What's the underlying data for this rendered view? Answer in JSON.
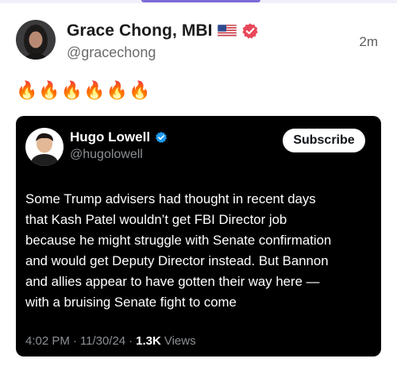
{
  "author": {
    "name": "Grace Chong, MBI",
    "flag": "🇺🇸",
    "handle": "@gracechong",
    "verified_icon": "verified-badge-icon",
    "verified_color": "#e8485a"
  },
  "post": {
    "timestamp": "2m",
    "text": "🔥🔥🔥🔥🔥🔥"
  },
  "embed": {
    "author_name": "Hugo Lowell",
    "author_handle": "@hugolowell",
    "verified_color": "#1d9bf0",
    "subscribe_label": "Subscribe",
    "body_lines": [
      "Some Trump advisers had thought in recent days",
      "that Kash Patel wouldn’t get FBI Director job",
      "because he might struggle with Senate confirmation",
      "and would get Deputy Director instead. But Bannon",
      "and allies appear to have gotten their way here —",
      "with a bruising Senate fight to come"
    ],
    "meta": {
      "time": "4:02 PM",
      "sep1": "·",
      "date": "11/30/24",
      "sep2": "·",
      "views_count": "1.3K",
      "views_label": "Views"
    }
  },
  "colors": {
    "accent": "#7f6bd6",
    "card_bg": "#000000"
  }
}
